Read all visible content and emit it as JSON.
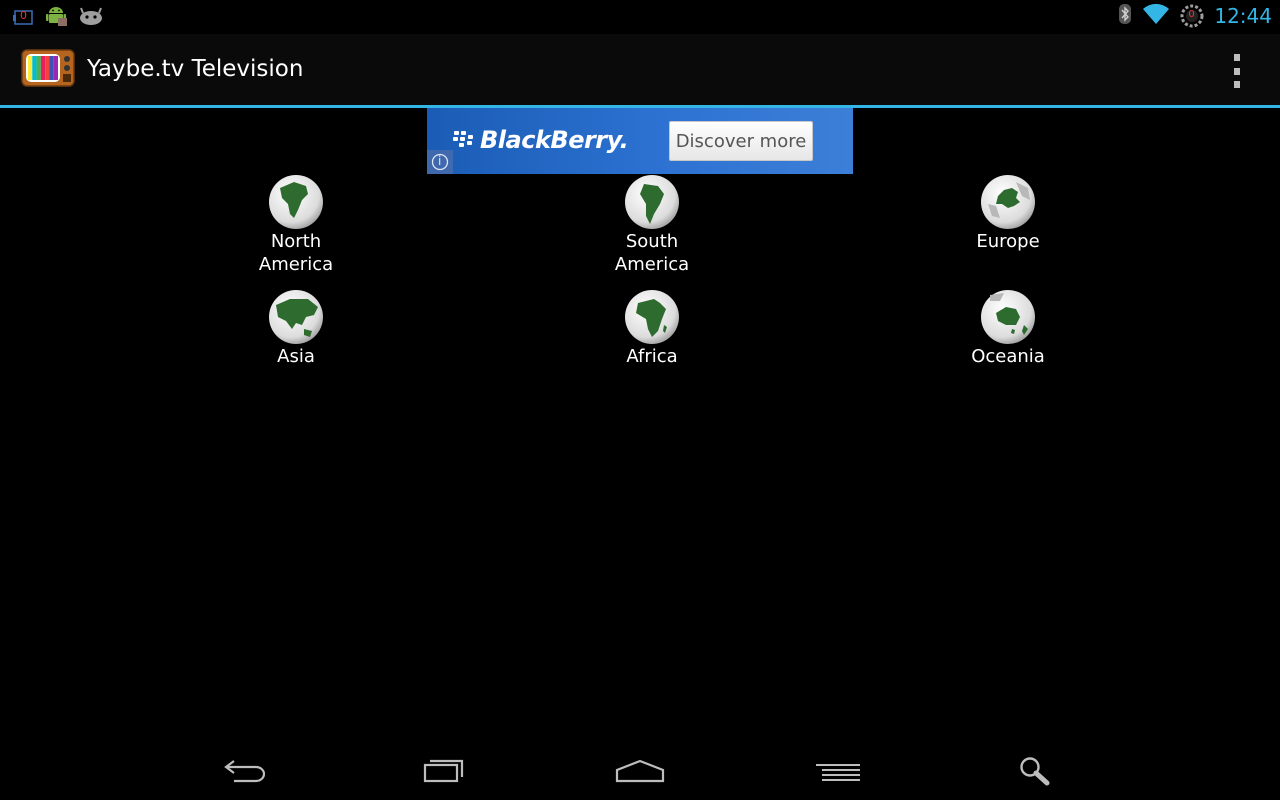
{
  "status_bar": {
    "clock": "12:44",
    "notification_badge": "0",
    "alarm_badge": "0",
    "accent_color": "#33b5e5"
  },
  "action_bar": {
    "title": "Yaybe.tv Television",
    "underline_color": "#33b5e5"
  },
  "ad": {
    "brand": "BlackBerry.",
    "button_label": "Discover more",
    "info_glyph": "i"
  },
  "continents": [
    {
      "id": "north-america",
      "label_line1": "North",
      "label_line2": "America"
    },
    {
      "id": "south-america",
      "label_line1": "South",
      "label_line2": "America"
    },
    {
      "id": "europe",
      "label_line1": "Europe",
      "label_line2": ""
    },
    {
      "id": "asia",
      "label_line1": "Asia",
      "label_line2": ""
    },
    {
      "id": "africa",
      "label_line1": "Africa",
      "label_line2": ""
    },
    {
      "id": "oceania",
      "label_line1": "Oceania",
      "label_line2": ""
    }
  ],
  "icons": {
    "status_left": [
      "notification-counter-icon",
      "android-debug-icon",
      "android-robot-icon"
    ],
    "status_right": [
      "bluetooth-icon",
      "wifi-icon",
      "alarm-counter-icon"
    ],
    "nav": [
      "back-icon",
      "recent-apps-icon",
      "home-icon",
      "menu-icon",
      "search-icon"
    ],
    "globe_land_color": "#2e6b2e"
  }
}
